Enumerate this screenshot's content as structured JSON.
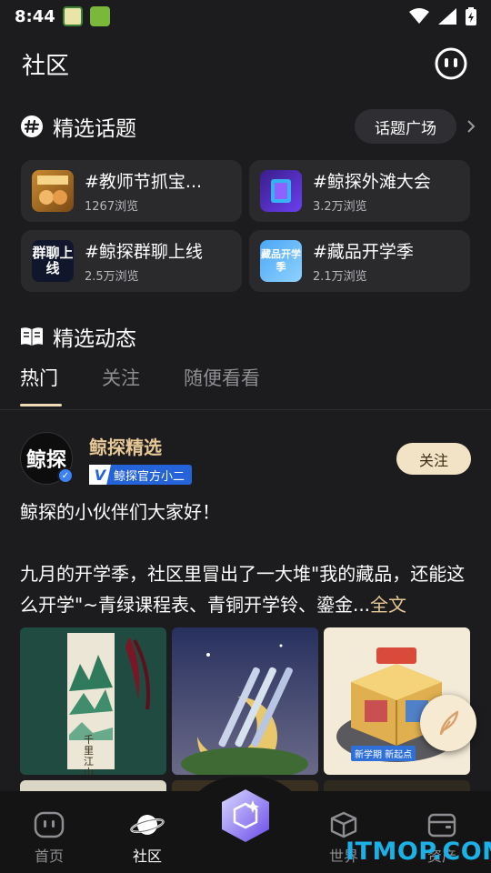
{
  "status_bar": {
    "time": "8:44"
  },
  "header": {
    "title": "社区"
  },
  "featured_topics": {
    "title": "精选话题",
    "plaza_label": "话题广场",
    "topics": [
      {
        "name": "#教师节抓宝...",
        "views": "1267浏览",
        "thumb_text": ""
      },
      {
        "name": "#鲸探外滩大会",
        "views": "3.2万浏览",
        "thumb_text": ""
      },
      {
        "name": "#鲸探群聊上线",
        "views": "2.5万浏览",
        "thumb_text": "群聊上线"
      },
      {
        "name": "#藏品开学季",
        "views": "2.1万浏览",
        "thumb_text": "藏品开学季"
      }
    ]
  },
  "featured_feed": {
    "title": "精选动态",
    "tabs": [
      "热门",
      "关注",
      "随便看看"
    ],
    "active_tab": 0
  },
  "post": {
    "avatar_text": "鲸探",
    "author": "鲸探精选",
    "tag_mark": "V",
    "tag": "鲸探官方小二",
    "follow_label": "关注",
    "line1": "鲸探的小伙伴们大家好！",
    "line2": "九月的开学季，社区里冒出了一大堆\"我的藏品，还能这么开学\"~青绿课程表、青铜开学铃、鎏金...",
    "read_more": "全文",
    "image1_text": "千里江山",
    "image3_text": "新学期 新起点"
  },
  "bottom_nav": {
    "items": [
      "首页",
      "社区",
      "世界",
      "资产"
    ],
    "active": 1
  },
  "watermark": "ITMOP.COM",
  "colors": {
    "accent": "#e6c897",
    "background": "#1c1c1e",
    "card": "#2a2a2d",
    "follow_bg": "#f3e3c6"
  }
}
